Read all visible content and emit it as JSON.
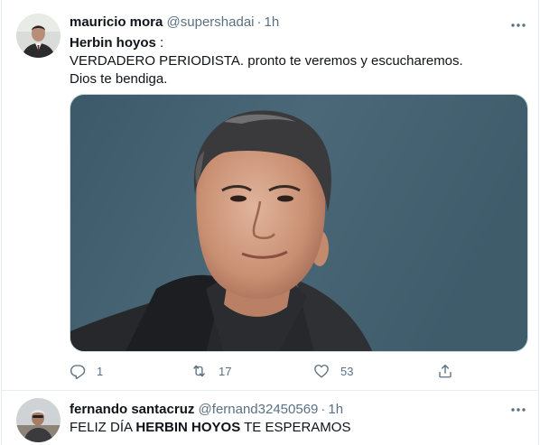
{
  "tweets": [
    {
      "name": "mauricio mora",
      "handle": "@supershadai",
      "separator": "·",
      "time": "1h",
      "mention": "Herbin hoyos",
      "mention_suffix": " :",
      "line2": "VERDADERO PERIODISTA. pronto te veremos y escucharemos.",
      "line3": "Dios te bendiga.",
      "replies": "1",
      "retweets": "17",
      "likes": "53"
    },
    {
      "name": "fernando santacruz",
      "handle": "@fernand32450569",
      "separator": "·",
      "time": "1h",
      "text_before": "FELIZ DÍA ",
      "text_bold": "HERBIN HOYOS",
      "text_after": " TE ESPERAMOS"
    }
  ],
  "icons": {
    "more": "more-horizontal-icon",
    "reply": "reply-icon",
    "retweet": "retweet-icon",
    "like": "heart-icon",
    "share": "share-icon"
  },
  "colors": {
    "secondary_text": "#5b7083",
    "divider": "#e6ecf0",
    "text": "#0f1419"
  }
}
